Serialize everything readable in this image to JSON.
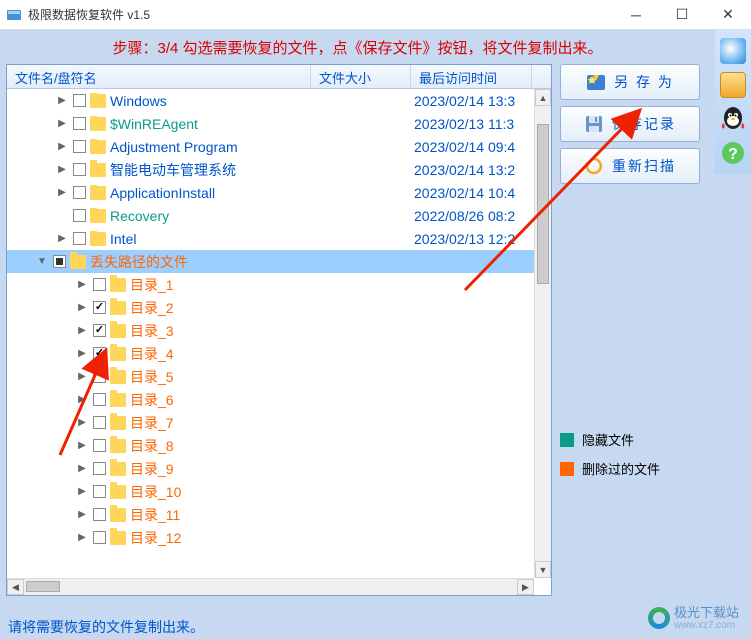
{
  "window": {
    "title": "极限数据恢复软件 v1.5"
  },
  "step": {
    "text": "步骤：3/4 勾选需要恢复的文件，点《保存文件》按钮，将文件复制出来。"
  },
  "columns": {
    "name": "文件名/盘符名",
    "size": "文件大小",
    "date": "最后访问时间"
  },
  "tree": [
    {
      "indent": 1,
      "exp": "▶",
      "cb": "",
      "label": "Windows",
      "color": "blue",
      "date": "2023/02/14 13:3"
    },
    {
      "indent": 1,
      "exp": "▶",
      "cb": "",
      "label": "$WinREAgent",
      "color": "teal",
      "date": "2023/02/13 11:3"
    },
    {
      "indent": 1,
      "exp": "▶",
      "cb": "",
      "label": "Adjustment Program",
      "color": "blue",
      "date": "2023/02/14 09:4"
    },
    {
      "indent": 1,
      "exp": "▶",
      "cb": "",
      "label": "智能电动车管理系统",
      "color": "blue",
      "date": "2023/02/14 13:2"
    },
    {
      "indent": 1,
      "exp": "▶",
      "cb": "",
      "label": "ApplicationInstall",
      "color": "blue",
      "date": "2023/02/14 10:4"
    },
    {
      "indent": 1,
      "exp": "",
      "cb": "",
      "label": "Recovery",
      "color": "teal",
      "date": "2022/08/26 08:2"
    },
    {
      "indent": 1,
      "exp": "▶",
      "cb": "",
      "label": "Intel",
      "color": "blue",
      "date": "2023/02/13 12:2"
    },
    {
      "indent": 0,
      "exp": "▼",
      "cb": "indet",
      "label": "丢失路径的文件",
      "color": "orange",
      "date": "",
      "selected": true
    },
    {
      "indent": 2,
      "exp": "▶",
      "cb": "",
      "label": "目录_1",
      "color": "orange",
      "date": ""
    },
    {
      "indent": 2,
      "exp": "▶",
      "cb": "checked",
      "label": "目录_2",
      "color": "orange",
      "date": ""
    },
    {
      "indent": 2,
      "exp": "▶",
      "cb": "checked",
      "label": "目录_3",
      "color": "orange",
      "date": ""
    },
    {
      "indent": 2,
      "exp": "▶",
      "cb": "checked",
      "label": "目录_4",
      "color": "orange",
      "date": ""
    },
    {
      "indent": 2,
      "exp": "▶",
      "cb": "",
      "label": "目录_5",
      "color": "orange",
      "date": ""
    },
    {
      "indent": 2,
      "exp": "▶",
      "cb": "",
      "label": "目录_6",
      "color": "orange",
      "date": ""
    },
    {
      "indent": 2,
      "exp": "▶",
      "cb": "",
      "label": "目录_7",
      "color": "orange",
      "date": ""
    },
    {
      "indent": 2,
      "exp": "▶",
      "cb": "",
      "label": "目录_8",
      "color": "orange",
      "date": ""
    },
    {
      "indent": 2,
      "exp": "▶",
      "cb": "",
      "label": "目录_9",
      "color": "orange",
      "date": ""
    },
    {
      "indent": 2,
      "exp": "▶",
      "cb": "",
      "label": "目录_10",
      "color": "orange",
      "date": ""
    },
    {
      "indent": 2,
      "exp": "▶",
      "cb": "",
      "label": "目录_11",
      "color": "orange",
      "date": ""
    },
    {
      "indent": 2,
      "exp": "▶",
      "cb": "",
      "label": "目录_12",
      "color": "orange",
      "date": ""
    }
  ],
  "buttons": {
    "saveAs": "另 存 为",
    "saveLog": "保存记录",
    "rescan": "重新扫描"
  },
  "legend": {
    "hidden": {
      "label": "隐藏文件",
      "color": "#0a9b8a"
    },
    "deleted": {
      "label": "删除过的文件",
      "color": "#ff6600"
    }
  },
  "status": {
    "text": "请将需要恢复的文件复制出来。"
  },
  "watermark": {
    "name": "极光下载站",
    "url": "www.xz7.com"
  }
}
